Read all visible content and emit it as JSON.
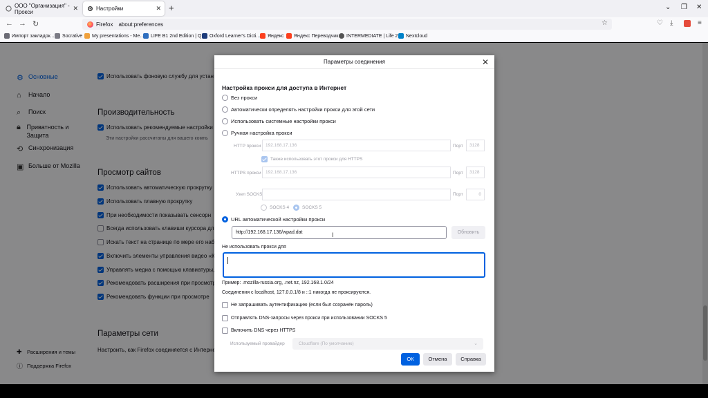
{
  "tabs": [
    {
      "title": "ООО \"Организация\" - Прокси",
      "icon": "blank-page-icon"
    },
    {
      "title": "Настройки",
      "icon": "gear-icon"
    }
  ],
  "navbar": {
    "brand": "Firefox",
    "url": "about:preferences"
  },
  "bookmarks": [
    {
      "label": "Импорт закладок...",
      "color": "#6b6b75"
    },
    {
      "label": "Socrative",
      "color": "#7b7b85"
    },
    {
      "label": "My presentations - Me...",
      "color": "#f0a13c"
    },
    {
      "label": "LIFE B1 2nd Edition | Q...",
      "color": "#2f6fbf"
    },
    {
      "label": "Oxford Learner's Dicti...",
      "color": "#1d3b7a"
    },
    {
      "label": "Яндекс",
      "color": "#fc3f1d"
    },
    {
      "label": "Яндекс Переводчик",
      "color": "#fc3f1d"
    },
    {
      "label": "INTERMEDIATE | Life 2...",
      "color": "#555555"
    },
    {
      "label": "Nextcloud",
      "color": "#0082c9"
    }
  ],
  "sidebar": {
    "items": [
      {
        "label": "Основные",
        "icon": "gear-icon"
      },
      {
        "label": "Начало",
        "icon": "home-icon"
      },
      {
        "label": "Поиск",
        "icon": "search-icon"
      },
      {
        "label": "Приватность и Защита",
        "icon": "lock-icon"
      },
      {
        "label": "Синхронизация",
        "icon": "sync-icon"
      },
      {
        "label": "Больше от Mozilla",
        "icon": "mozilla-icon"
      }
    ],
    "footer": [
      {
        "label": "Расширения и темы",
        "icon": "puzzle-icon"
      },
      {
        "label": "Поддержка Firefox",
        "icon": "help-icon"
      }
    ]
  },
  "content": {
    "bg_service": "Использовать фоновую службу для устан",
    "perf_heading": "Производительность",
    "perf_recommended": "Использовать рекомендуемые настройки",
    "perf_note": "Эти настройки рассчитаны для вашего компь",
    "browsing_heading": "Просмотр сайтов",
    "browsing_items": [
      {
        "label": "Использовать автоматическую прокрутку",
        "checked": true
      },
      {
        "label": "Использовать плавную прокрутку",
        "checked": true
      },
      {
        "label": "При необходимости показывать сенсорн",
        "checked": true
      },
      {
        "label": "Всегда использовать клавиши курсора дл",
        "checked": false
      },
      {
        "label": "Искать текст на странице по мере его наб",
        "checked": false
      },
      {
        "label": "Включить элементы управления видео «К",
        "checked": true
      },
      {
        "label": "Управлять медиа с помощью клавиатуры,",
        "checked": true
      },
      {
        "label": "Рекомендовать расширения при просмотр",
        "checked": true
      },
      {
        "label": "Рекомендовать функции при просмотре",
        "checked": true
      }
    ],
    "network_heading": "Параметры сети",
    "network_text": "Настроить, как Firefox соединяется с Интерне"
  },
  "dialog": {
    "title": "Параметры соединения",
    "heading": "Настройка прокси для доступа в Интернет",
    "radios": [
      {
        "label": "Без прокси",
        "selected": false
      },
      {
        "label": "Автоматически определять настройки прокси для этой сети",
        "selected": false
      },
      {
        "label": "Использовать системные настройки прокси",
        "selected": false
      },
      {
        "label": "Ручная настройка прокси",
        "selected": false
      }
    ],
    "http_label": "HTTP прокси",
    "http_value": "192.168.17.136",
    "port_label": "Порт",
    "http_port": "3128",
    "also_https": "Также использовать этот прокси для HTTPS",
    "https_label": "HTTPS прокси",
    "https_value": "192.168.17.136",
    "https_port": "3128",
    "socks_label": "Узел SOCKS",
    "socks_value": "",
    "socks_port": "0",
    "socks4": "SOCKS 4",
    "socks5": "SOCKS 5",
    "pac_radio": "URL автоматической настройки прокси",
    "pac_value": "http://192.168.17.136/wpad.dat",
    "reload": "Обновить",
    "noproxy_label": "Не использовать прокси для",
    "example": "Пример: .mozilla-russia.org, .net.nz, 192.168.1.0/24",
    "localhost_note": "Соединения с localhost, 127.0.0.1/8 и ::1 никогда не проксируются.",
    "options": [
      {
        "label": "Не запрашивать аутентификацию (если был сохранён пароль)",
        "checked": false
      },
      {
        "label": "Отправлять DNS-запросы через прокси при использовании SOCKS 5",
        "checked": false
      },
      {
        "label": "Включить DNS через HTTPS",
        "checked": false
      }
    ],
    "provider_label": "Используемый провайдер",
    "provider_value": "Cloudflare (По умолчанию)",
    "ok": "ОК",
    "cancel": "Отмена",
    "help": "Справка"
  }
}
